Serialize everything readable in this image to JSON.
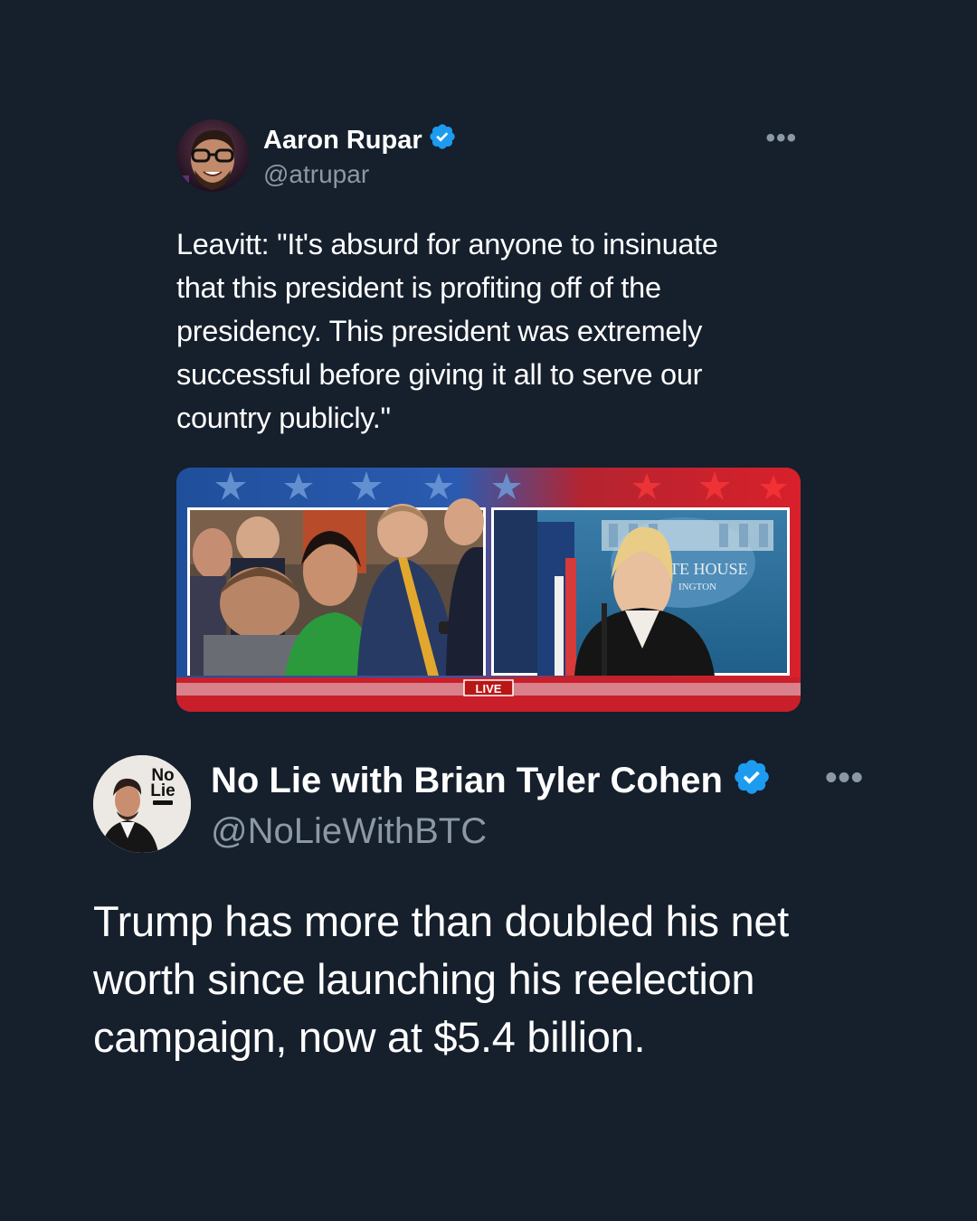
{
  "tweets": [
    {
      "author_name": "Aaron Rupar",
      "handle": "@atrupar",
      "more_label": "•••",
      "text": "Leavitt: \"It's absurd for anyone to insinuate\nthat this president is profiting off of the\npresidency. This president was extremely\nsuccessful before giving it all to serve our\ncountry publicly.\"",
      "media": {
        "live_label": "LIVE",
        "backdrop_text_1": "TE HOUSE",
        "backdrop_text_2": "INGTON"
      }
    },
    {
      "author_name": "No Lie with Brian Tyler Cohen",
      "handle": "@NoLieWithBTC",
      "more_label": "•••",
      "avatar_logo_line1": "No",
      "avatar_logo_line2": "Lie",
      "text": "Trump has more than doubled his net\nworth since launching his reelection\ncampaign, now at $5.4 billion."
    }
  ],
  "colors": {
    "background": "#161f2c",
    "verified_badge": "#1d9bf0",
    "handle_text": "#8b98a5",
    "live_badge": "#d21a1a"
  },
  "icons": [
    "verified-badge-icon",
    "more-options-icon"
  ]
}
